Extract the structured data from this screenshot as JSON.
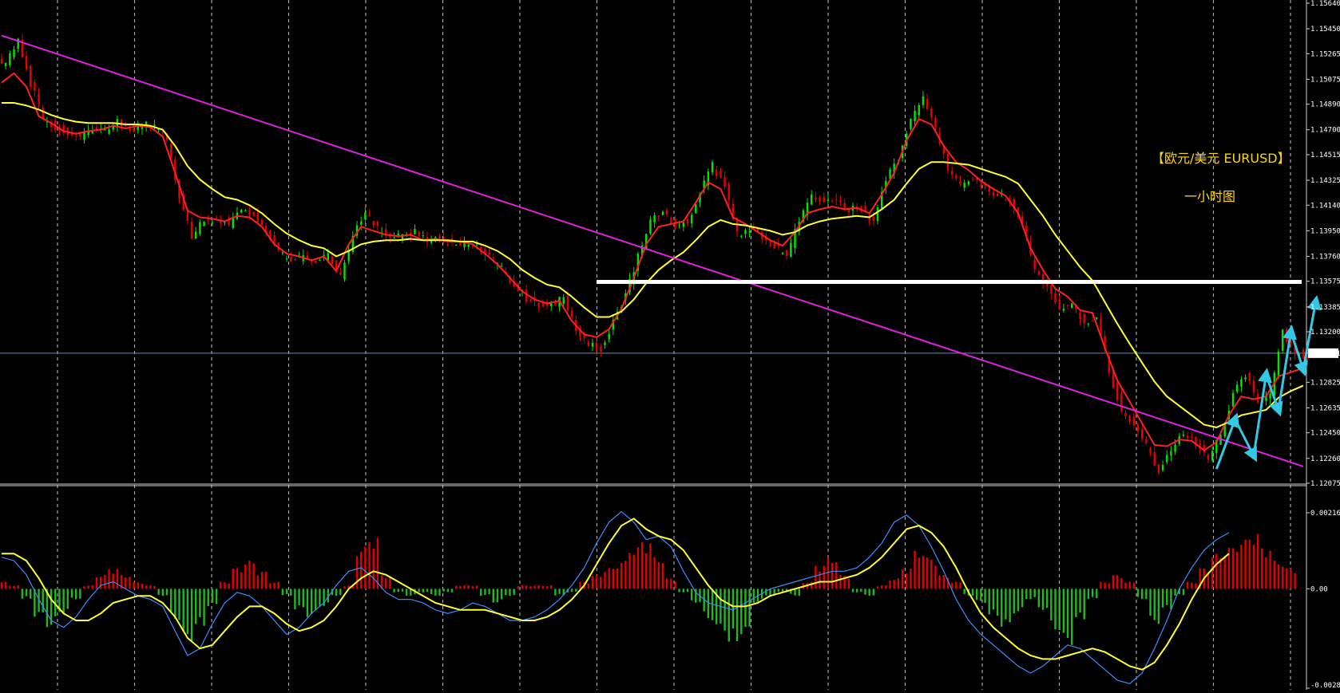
{
  "annotation": {
    "title": "【欧元/美元 EURUSD】",
    "subtitle": "一小时图"
  },
  "colors": {
    "background": "#000000",
    "candle_up": "#00e600",
    "candle_down": "#e60000",
    "ma_fast": "#ff2020",
    "ma_slow": "#ffff33",
    "trendline": "#e020e0",
    "support": "#ffffff",
    "arrows": "#33c8e6",
    "osc_pos": "#e00000",
    "osc_neg": "#22b822",
    "osc_signal": "#ffff33",
    "osc_main": "#3a8cff",
    "grid": "#d0d0d0"
  },
  "chart_data": [
    {
      "type": "candlestick",
      "name": "EURUSD H1",
      "ylim": [
        1.12075,
        1.1564
      ],
      "grid": "vertical dashed",
      "y_tick_labels": [
        "1.15640",
        "1.15450",
        "1.15265",
        "1.15075",
        "1.14890",
        "1.14700",
        "1.14515",
        "1.14325",
        "1.14140",
        "1.13950",
        "1.13760",
        "1.13575",
        "1.13385",
        "1.13200",
        "1.13041",
        "1.12825",
        "1.12635",
        "1.12450",
        "1.12260",
        "1.12075"
      ],
      "current_price": "1.13041",
      "close_path": [
        1.152,
        1.1535,
        1.1505,
        1.1478,
        1.1472,
        1.1468,
        1.1465,
        1.1472,
        1.147,
        1.1478,
        1.147,
        1.1475,
        1.1472,
        1.1462,
        1.142,
        1.1392,
        1.1402,
        1.1404,
        1.14,
        1.141,
        1.1406,
        1.1395,
        1.1378,
        1.1374,
        1.1376,
        1.1372,
        1.1378,
        1.136,
        1.1392,
        1.1408,
        1.1396,
        1.139,
        1.1391,
        1.1394,
        1.1387,
        1.1389,
        1.1385,
        1.1386,
        1.1384,
        1.1376,
        1.1366,
        1.1355,
        1.1345,
        1.134,
        1.1339,
        1.1345,
        1.132,
        1.131,
        1.1308,
        1.1328,
        1.1348,
        1.1375,
        1.1402,
        1.1408,
        1.1398,
        1.1402,
        1.1425,
        1.1443,
        1.1428,
        1.1392,
        1.1396,
        1.139,
        1.1383,
        1.1376,
        1.1402,
        1.142,
        1.1416,
        1.1417,
        1.141,
        1.1412,
        1.1402,
        1.1435,
        1.1448,
        1.1478,
        1.1494,
        1.147,
        1.1442,
        1.1428,
        1.1434,
        1.1426,
        1.1422,
        1.1418,
        1.14,
        1.1364,
        1.1352,
        1.1336,
        1.134,
        1.1326,
        1.1332,
        1.129,
        1.1262,
        1.1252,
        1.1236,
        1.1215,
        1.1232,
        1.1245,
        1.1237,
        1.1225,
        1.1243,
        1.1273,
        1.1288,
        1.1267,
        1.1272,
        1.132,
        1.1305,
        1.1302
      ],
      "moving_averages": [
        {
          "color": "#ff2020",
          "values": [
            1.1505,
            1.1512,
            1.1502,
            1.148,
            1.1475,
            1.1469,
            1.1467,
            1.1469,
            1.147,
            1.1473,
            1.1471,
            1.1473,
            1.1472,
            1.1465,
            1.1438,
            1.141,
            1.1405,
            1.1404,
            1.1402,
            1.1406,
            1.1405,
            1.1398,
            1.1385,
            1.1378,
            1.1376,
            1.1373,
            1.1376,
            1.1365,
            1.1385,
            1.1398,
            1.1395,
            1.1392,
            1.1391,
            1.1392,
            1.1388,
            1.1389,
            1.1387,
            1.1387,
            1.1385,
            1.1378,
            1.137,
            1.136,
            1.135,
            1.1344,
            1.1341,
            1.1343,
            1.1328,
            1.1318,
            1.1316,
            1.1322,
            1.1337,
            1.136,
            1.1385,
            1.1398,
            1.14,
            1.1402,
            1.1416,
            1.1431,
            1.1426,
            1.1405,
            1.14,
            1.1394,
            1.1388,
            1.1384,
            1.1394,
            1.1408,
            1.1411,
            1.1413,
            1.1411,
            1.1412,
            1.1408,
            1.1422,
            1.1438,
            1.1462,
            1.1478,
            1.1474,
            1.1458,
            1.1446,
            1.144,
            1.1432,
            1.1426,
            1.1421,
            1.1408,
            1.1382,
            1.1366,
            1.1352,
            1.1346,
            1.1336,
            1.1334,
            1.1308,
            1.1284,
            1.1268,
            1.1252,
            1.1236,
            1.1235,
            1.124,
            1.1239,
            1.1232,
            1.1238,
            1.1258,
            1.1272,
            1.127,
            1.1272,
            1.1287,
            1.129,
            1.1293
          ]
        },
        {
          "color": "#ffff33",
          "values": [
            1.149,
            1.149,
            1.1488,
            1.1485,
            1.1481,
            1.1478,
            1.1476,
            1.1475,
            1.1475,
            1.1475,
            1.1474,
            1.1474,
            1.1473,
            1.147,
            1.1458,
            1.1443,
            1.1433,
            1.1426,
            1.142,
            1.1418,
            1.1414,
            1.1408,
            1.14,
            1.1393,
            1.1388,
            1.1384,
            1.1382,
            1.1376,
            1.138,
            1.1385,
            1.1387,
            1.1388,
            1.1388,
            1.1389,
            1.1388,
            1.1388,
            1.1388,
            1.1387,
            1.1387,
            1.1384,
            1.138,
            1.1374,
            1.1366,
            1.136,
            1.1355,
            1.1353,
            1.1346,
            1.1338,
            1.1331,
            1.1331,
            1.1335,
            1.1344,
            1.1356,
            1.1366,
            1.1373,
            1.1379,
            1.1388,
            1.1398,
            1.1403,
            1.14,
            1.1399,
            1.1397,
            1.1395,
            1.1392,
            1.1394,
            1.1399,
            1.1402,
            1.1404,
            1.1405,
            1.1406,
            1.1405,
            1.1411,
            1.1418,
            1.143,
            1.1441,
            1.1446,
            1.1446,
            1.1445,
            1.1444,
            1.1441,
            1.1438,
            1.1435,
            1.143,
            1.1418,
            1.1406,
            1.1392,
            1.138,
            1.1368,
            1.1358,
            1.1342,
            1.1326,
            1.1311,
            1.1297,
            1.1283,
            1.1272,
            1.1265,
            1.1258,
            1.1251,
            1.1249,
            1.1253,
            1.1258,
            1.126,
            1.1262,
            1.1271,
            1.1276,
            1.128
          ]
        }
      ],
      "trendline": {
        "from": {
          "x": 0,
          "y": 1.154
        },
        "to": {
          "x": 105,
          "y": 1.122
        }
      },
      "support_level": 1.1357,
      "arrows": [
        {
          "from": {
            "x": 98,
            "y": 1.1218
          },
          "to": {
            "x": 99.5,
            "y": 1.1255
          }
        },
        {
          "from": {
            "x": 99.5,
            "y": 1.1255
          },
          "to": {
            "x": 101,
            "y": 1.1228
          }
        },
        {
          "from": {
            "x": 101,
            "y": 1.1228
          },
          "to": {
            "x": 102,
            "y": 1.1288
          }
        },
        {
          "from": {
            "x": 102,
            "y": 1.1288
          },
          "to": {
            "x": 103,
            "y": 1.1262
          }
        },
        {
          "from": {
            "x": 103,
            "y": 1.1262
          },
          "to": {
            "x": 104,
            "y": 1.132
          }
        },
        {
          "from": {
            "x": 104,
            "y": 1.132
          },
          "to": {
            "x": 105,
            "y": 1.1292
          }
        },
        {
          "from": {
            "x": 105,
            "y": 1.1292
          },
          "to": {
            "x": 106,
            "y": 1.1342
          }
        }
      ]
    },
    {
      "type": "histogram",
      "name": "MACD",
      "y_tick_labels": [
        "0.002165",
        "0.00",
        "-0.00283"
      ],
      "ylim": [
        -0.00283,
        0.002165
      ],
      "histogram": [
        0.0002,
        0.0001,
        -0.0003,
        -0.0008,
        -0.0011,
        -0.0007,
        -0.0003,
        0.0001,
        0.0004,
        0.0006,
        0.0004,
        0.0002,
        0.0001,
        -0.0002,
        -0.0009,
        -0.0015,
        -0.0011,
        -0.0005,
        0.0002,
        0.0006,
        0.0008,
        0.0005,
        0.0002,
        -0.0002,
        -0.0006,
        -0.0008,
        -0.0005,
        -0.0002,
        0.0001,
        0.0012,
        0.0015,
        0.0004,
        -0.0001,
        -0.0002,
        -0.0001,
        -0.0002,
        -0.0001,
        0.0001,
        0.0001,
        -0.0002,
        -0.0004,
        -0.0002,
        0.0001,
        0.0001,
        0.0001,
        -0.0002,
        -0.0001,
        0.0002,
        0.0004,
        0.0006,
        0.0008,
        0.0012,
        0.0014,
        0.0009,
        0.0003,
        -0.0001,
        -0.0004,
        -0.0009,
        -0.0012,
        -0.0016,
        -0.0013,
        -0.0004,
        -0.0002,
        -0.0001,
        -0.0002,
        0.0002,
        0.0007,
        0.0009,
        0.0004,
        -0.0001,
        -0.0002,
        0.0001,
        0.0003,
        0.0006,
        0.0011,
        0.0009,
        0.0004,
        0.0002,
        -0.0002,
        -0.0004,
        -0.0008,
        -0.0011,
        -0.0007,
        -0.0003,
        -0.0006,
        -0.0012,
        -0.0016,
        -0.0009,
        -0.0003,
        0.0002,
        0.0004,
        0.0002,
        -0.0003,
        -0.001,
        -0.0006,
        -0.0002,
        0.0002,
        0.0006,
        0.001,
        0.0012,
        0.0014,
        0.0016,
        0.0012,
        0.0008,
        0.0006
      ],
      "series": [
        {
          "color": "#3a8cff",
          "values": [
            0.0009,
            0.0008,
            0.0004,
            -0.0003,
            -0.0009,
            -0.0011,
            -0.0008,
            -0.0003,
            0.0001,
            0.0002,
            0.0,
            -0.0002,
            -0.0003,
            -0.0005,
            -0.0012,
            -0.0019,
            -0.0017,
            -0.001,
            -0.0004,
            -0.0001,
            -0.0002,
            -0.0005,
            -0.0009,
            -0.0013,
            -0.0011,
            -0.0007,
            -0.0004,
            0.0001,
            0.0005,
            0.0006,
            0.0003,
            -0.0001,
            -0.0003,
            -0.0003,
            -0.0004,
            -0.0006,
            -0.0007,
            -0.0006,
            -0.0004,
            -0.0005,
            -0.0007,
            -0.0009,
            -0.0009,
            -0.0008,
            -0.0006,
            -0.0003,
            0.0001,
            0.0006,
            0.0013,
            0.0019,
            0.0022,
            0.0019,
            0.0014,
            0.0015,
            0.0012,
            0.0005,
            -0.0001,
            -0.0004,
            -0.0005,
            -0.0006,
            -0.0004,
            -0.0002,
            0.0,
            0.0001,
            0.0002,
            0.0003,
            0.0004,
            0.0005,
            0.0005,
            0.0006,
            0.0009,
            0.0013,
            0.0019,
            0.0021,
            0.0018,
            0.0012,
            0.0005,
            -0.0003,
            -0.0009,
            -0.0013,
            -0.0016,
            -0.0019,
            -0.0022,
            -0.0024,
            -0.0022,
            -0.0019,
            -0.0016,
            -0.0017,
            -0.002,
            -0.0023,
            -0.0026,
            -0.0027,
            -0.0024,
            -0.0017,
            -0.0009,
            0.0,
            0.0006,
            0.0011,
            0.0014,
            0.0016
          ]
        },
        {
          "color": "#ffff33",
          "values": [
            0.001,
            0.001,
            0.0008,
            0.0003,
            -0.0003,
            -0.0007,
            -0.0009,
            -0.0009,
            -0.0007,
            -0.0004,
            -0.0003,
            -0.0002,
            -0.0002,
            -0.0004,
            -0.0008,
            -0.0014,
            -0.0017,
            -0.0016,
            -0.0012,
            -0.0008,
            -0.0005,
            -0.0005,
            -0.0007,
            -0.001,
            -0.0012,
            -0.0011,
            -0.0009,
            -0.0005,
            0.0,
            0.0003,
            0.0005,
            0.0004,
            0.0002,
            0.0,
            -0.0002,
            -0.0004,
            -0.0005,
            -0.0006,
            -0.0006,
            -0.0006,
            -0.0007,
            -0.0008,
            -0.0009,
            -0.0009,
            -0.0008,
            -0.0006,
            -0.0003,
            0.0001,
            0.0007,
            0.0013,
            0.0018,
            0.002,
            0.0017,
            0.0015,
            0.0014,
            0.0011,
            0.0006,
            0.0001,
            -0.0003,
            -0.0005,
            -0.0005,
            -0.0004,
            -0.0002,
            -0.0001,
            0.0,
            0.0001,
            0.0002,
            0.0002,
            0.0003,
            0.0004,
            0.0006,
            0.0009,
            0.0013,
            0.0017,
            0.0018,
            0.0016,
            0.0012,
            0.0006,
            -0.0001,
            -0.0007,
            -0.0011,
            -0.0014,
            -0.0017,
            -0.0019,
            -0.002,
            -0.002,
            -0.0019,
            -0.0018,
            -0.0017,
            -0.0018,
            -0.002,
            -0.0022,
            -0.0023,
            -0.0021,
            -0.0016,
            -0.001,
            -0.0003,
            0.0003,
            0.0007,
            0.001
          ]
        }
      ]
    }
  ]
}
